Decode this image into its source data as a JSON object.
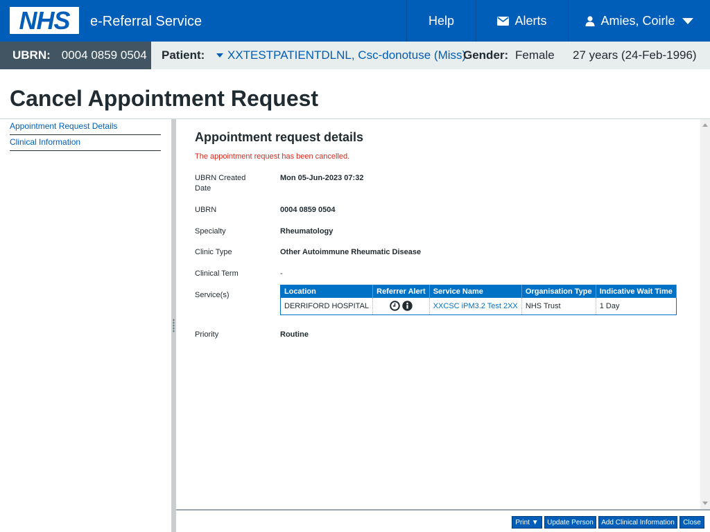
{
  "header": {
    "logo_text": "NHS",
    "service_name": "e-Referral Service",
    "nav": {
      "help": "Help",
      "alerts": "Alerts",
      "user": "Amies, Coirle"
    }
  },
  "patient_banner": {
    "ubrn_label": "UBRN:",
    "ubrn_value": "0004 0859 0504",
    "patient_label": "Patient:",
    "patient_name": "XXTESTPATIENTDLNL, Csc-donotuse (Miss)",
    "gender_label": "Gender:",
    "gender_value": "Female",
    "age_dob": "27 years (24-Feb-1996)"
  },
  "page": {
    "title": "Cancel Appointment Request"
  },
  "left_nav": [
    {
      "label": "Appointment Request Details"
    },
    {
      "label": "Clinical Information"
    }
  ],
  "details": {
    "section_title": "Appointment request details",
    "status_message": "The appointment request has been cancelled.",
    "ubrn_created_label": "UBRN Created Date",
    "ubrn_created_value": "Mon 05-Jun-2023 07:32",
    "ubrn_label": "UBRN",
    "ubrn_value": "0004 0859 0504",
    "specialty_label": "Specialty",
    "specialty_value": "Rheumatology",
    "clinic_type_label": "Clinic Type",
    "clinic_type_value": "Other Autoimmune Rheumatic Disease",
    "clinical_term_label": "Clinical Term",
    "clinical_term_value": "-",
    "services_label": "Service(s)",
    "priority_label": "Priority",
    "priority_value": "Routine"
  },
  "services_table": {
    "headers": [
      "Location",
      "Referrer Alert",
      "Service Name",
      "Organisation Type",
      "Indicative Wait Time"
    ],
    "rows": [
      {
        "location": "DERRIFORD HOSPITAL",
        "alert_icons": [
          "clock-icon",
          "info-icon"
        ],
        "service_name": "XXCSC iPM3.2 Test 2XX",
        "organisation_type": "NHS Trust",
        "wait_time": "1 Day"
      }
    ]
  },
  "footer_buttons": {
    "print": "Print ▼",
    "update_person": "Update Person",
    "add_clinical": "Add Clinical Information",
    "close": "Close"
  },
  "colors": {
    "nhs_blue": "#005eb8",
    "banner_dark": "#425563",
    "alert_red": "#d5281b",
    "table_header": "#0072c6"
  }
}
